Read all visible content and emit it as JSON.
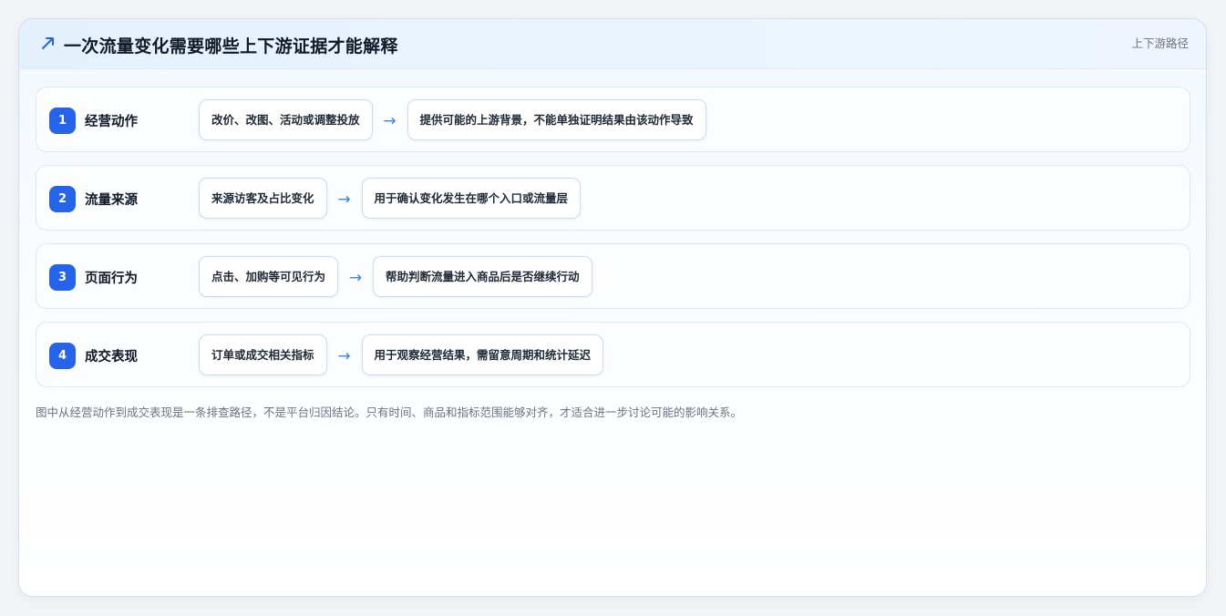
{
  "header": {
    "icon": "trend-arrow-icon",
    "title": "一次流量变化需要哪些上下游证据才能解释",
    "tag": "上下游路径"
  },
  "steps": [
    {
      "number": "1",
      "label": "经营动作",
      "evidence": "改价、改图、活动或调整投放",
      "arrow": "→",
      "meaning": "提供可能的上游背景，不能单独证明结果由该动作导致"
    },
    {
      "number": "2",
      "label": "流量来源",
      "evidence": "来源访客及占比变化",
      "arrow": "→",
      "meaning": "用于确认变化发生在哪个入口或流量层"
    },
    {
      "number": "3",
      "label": "页面行为",
      "evidence": "点击、加购等可见行为",
      "arrow": "→",
      "meaning": "帮助判断流量进入商品后是否继续行动"
    },
    {
      "number": "4",
      "label": "成交表现",
      "evidence": "订单或成交相关指标",
      "arrow": "→",
      "meaning": "用于观察经营结果，需留意周期和统计延迟"
    }
  ],
  "footnote": "图中从经营动作到成交表现是一条排查路径，不是平台归因结论。只有时间、商品和指标范围能够对齐，才适合进一步讨论可能的影响关系。",
  "colors": {
    "accent": "#2563eb",
    "arrow": "#3b82f6",
    "title": "#111827",
    "muted": "#6b7280"
  }
}
